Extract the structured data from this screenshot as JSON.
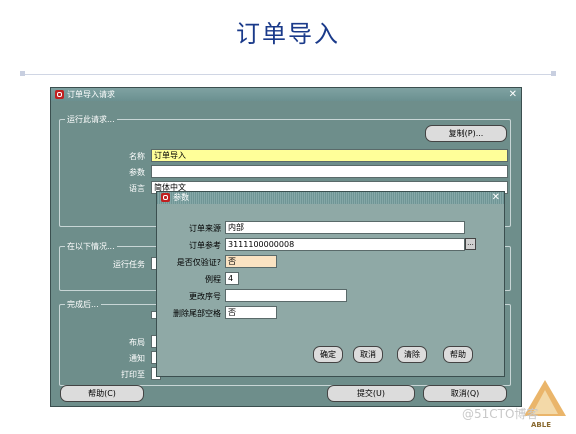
{
  "slide": {
    "title": "订单导入"
  },
  "main_window": {
    "title": "订单导入请求",
    "close": "✕",
    "group_run": {
      "label": "运行此请求..."
    },
    "copy_button": "复制(P)...",
    "name_label": "名称",
    "name_value": "订单导入",
    "params_label": "参数",
    "params_value": "",
    "language_label": "语言",
    "language_value": "简体中文",
    "group_conditions": {
      "label": "在以下情况..."
    },
    "run_task_label": "运行任务",
    "group_after": {
      "label": "完成后..."
    },
    "layout_label": "布局",
    "notify_label": "通知",
    "print_label": "打印至",
    "help_button": "帮助(C)",
    "submit_button": "提交(U)",
    "cancel_button": "取消(Q)"
  },
  "param_dialog": {
    "title": "参数",
    "close": "✕",
    "fields": [
      {
        "label": "订单来源",
        "value": "内部"
      },
      {
        "label": "订单参考",
        "value": "3111100000008"
      },
      {
        "label": "是否仅验证?",
        "value": "否"
      },
      {
        "label": "例程",
        "value": "4"
      },
      {
        "label": "更改序号",
        "value": ""
      },
      {
        "label": "删除尾部空格",
        "value": "否"
      }
    ],
    "lov_button": "...",
    "buttons": {
      "ok": "确定",
      "cancel": "取消",
      "clear": "清除",
      "help": "帮助"
    }
  },
  "footer": {
    "logo_text": "ABLE",
    "watermark": "@51CTO博客"
  },
  "colors": {
    "title": "#1a3a8a",
    "panel": "#6e8e8b",
    "dialog": "#8fa9a6",
    "titlebar": "#6b9090"
  }
}
